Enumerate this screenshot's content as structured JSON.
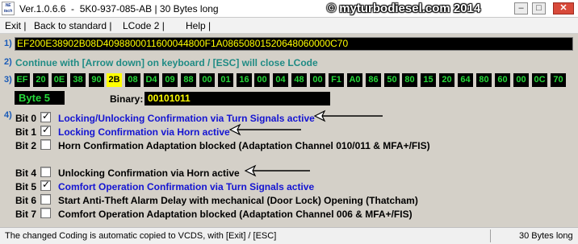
{
  "window": {
    "icon_text_1": "NE",
    "icon_text_2": "tech",
    "title": "Ver.1.0.6.6  -  5K0-937-085-AB | 30 Bytes long",
    "copyright": "© myturbodiesel.com 2014",
    "min_label": "–",
    "max_label": "□",
    "close_label": "✕"
  },
  "menu": {
    "exit": "Exit |",
    "back": "Back to standard |",
    "lcode2": "LCode 2 |",
    "help": "Help |"
  },
  "section_labels": {
    "s1": "1)",
    "s2": "2)",
    "s3": "3)",
    "s4": "4)"
  },
  "hex_string": "EF200E38902B08D4098800011600044800F1A08650801520648060000C70",
  "hint": "Continue with [Arrow down] on keyboard / [ESC] will close LCode",
  "bytes": [
    "EF",
    "20",
    "0E",
    "38",
    "90",
    "2B",
    "08",
    "D4",
    "09",
    "88",
    "00",
    "01",
    "16",
    "00",
    "04",
    "48",
    "00",
    "F1",
    "A0",
    "86",
    "50",
    "80",
    "15",
    "20",
    "64",
    "80",
    "60",
    "00",
    "0C",
    "70"
  ],
  "selected_byte_index": 5,
  "byte_label": "Byte 5",
  "binary_label": "Binary:",
  "binary_value": "00101011",
  "bits": [
    {
      "name": "Bit 0",
      "checked": true,
      "desc": "Locking/Unlocking Confirmation via Turn Signals active"
    },
    {
      "name": "Bit 1",
      "checked": true,
      "desc": "Locking Confirmation via Horn active"
    },
    {
      "name": "Bit 2",
      "checked": false,
      "desc": "Horn Confirmation Adaptation blocked (Adaptation Channel 010/011 & MFA+/FIS)"
    },
    {
      "name": "Bit 4",
      "checked": false,
      "desc": "Unlocking Confirmation via Horn active"
    },
    {
      "name": "Bit 5",
      "checked": true,
      "desc": "Comfort Operation Confirmation via Turn Signals active"
    },
    {
      "name": "Bit 6",
      "checked": false,
      "desc": "Start Anti-Theft Alarm Delay with mechanical (Door Lock) Opening (Thatcham)"
    },
    {
      "name": "Bit 7",
      "checked": false,
      "desc": "Comfort Operation Adaptation blocked (Adaptation Channel 006 & MFA+/FIS)"
    }
  ],
  "check_glyph": "✓",
  "status": {
    "left": "The changed Coding is automatic copied to VCDS, with [Exit] / [ESC]",
    "right": "30 Bytes long"
  },
  "colors": {
    "active_text": "#1414d2",
    "byte_text": "#26d93a",
    "hex_text": "#ffff00",
    "hint_text": "#1f8b84",
    "section_num": "#1a5bb8"
  }
}
